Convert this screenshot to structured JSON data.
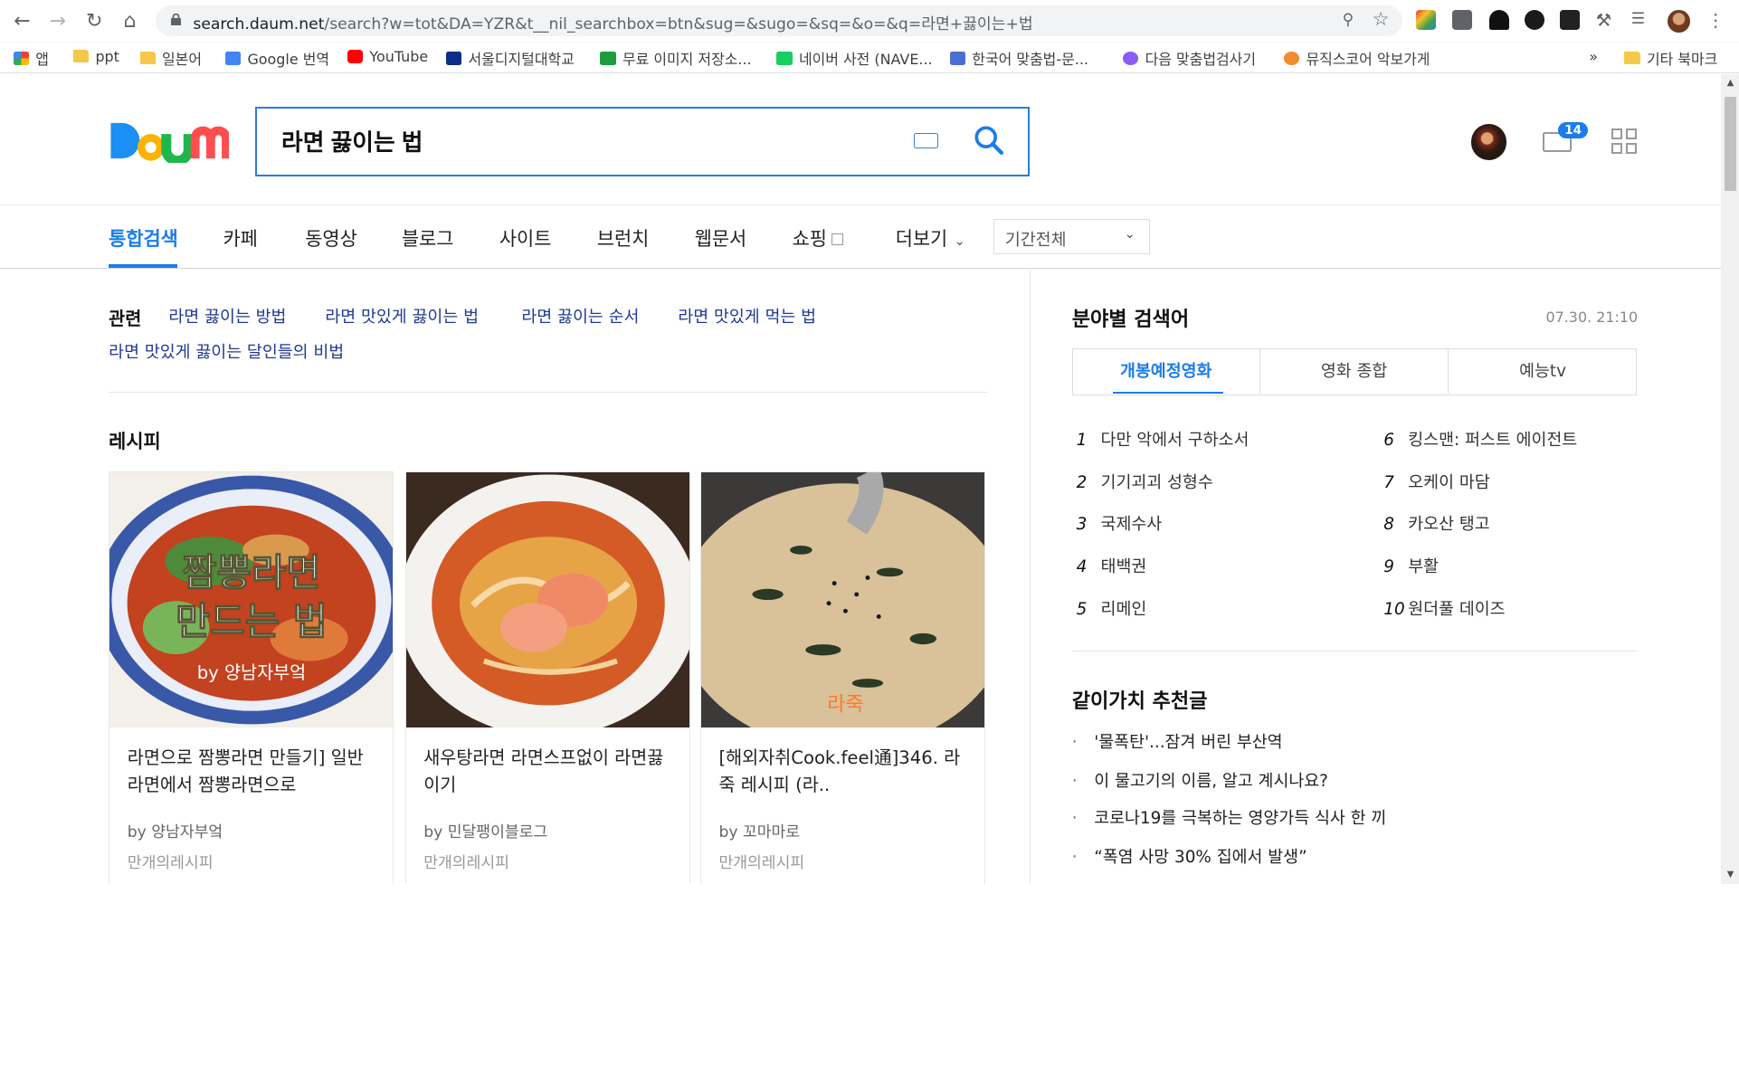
{
  "browser": {
    "url_domain": "search.daum.net",
    "url_rest": "/search?w=tot&DA=YZR&t__nil_searchbox=btn&sug=&sugo=&sq=&o=&q=라면+끓이는+법",
    "bookmarks": [
      {
        "label": "앱"
      },
      {
        "label": "ppt"
      },
      {
        "label": "일본어"
      },
      {
        "label": "Google 번역"
      },
      {
        "label": "YouTube"
      },
      {
        "label": "서울디지털대학교"
      },
      {
        "label": "무료 이미지 저장소..."
      },
      {
        "label": "네이버 사전 (NAVE..."
      },
      {
        "label": "한국어 맞춤법-문..."
      },
      {
        "label": "다음 맞춤법검사기"
      },
      {
        "label": "뮤직스코어 악보가게"
      },
      {
        "label": "»"
      },
      {
        "label": "기타 북마크"
      }
    ]
  },
  "header": {
    "search_query": "라면 끓이는 법",
    "mail_count": "14"
  },
  "tabs": [
    {
      "label": "통합검색"
    },
    {
      "label": "카페"
    },
    {
      "label": "동영상"
    },
    {
      "label": "블로그"
    },
    {
      "label": "사이트"
    },
    {
      "label": "브런치"
    },
    {
      "label": "웹문서"
    },
    {
      "label": "쇼핑"
    },
    {
      "label": "더보기"
    }
  ],
  "period_select": "기간전체",
  "related": {
    "label": "관련",
    "items": [
      "라면 끓이는 방법",
      "라면 맛있게 끓이는 법",
      "라면 끓이는 순서",
      "라면 맛있게 먹는 법",
      "라면 맛있게 끓이는 달인들의 비법"
    ]
  },
  "recipe": {
    "section_title": "레시피",
    "cards": [
      {
        "img_text": "짬뽕라면\n만드는 법",
        "img_credit": "by 양남자부엌",
        "title": "라면으로 짬뽕라면 만들기] 일반라면에서 짬뽕라면으로",
        "by": "by 양남자부엌",
        "source": "만개의레시피"
      },
      {
        "img_text": "",
        "img_credit": "",
        "title": "새우탕라면 라면스프없이 라면끓이기",
        "by": "by 민달팽이블로그",
        "source": "만개의레시피"
      },
      {
        "img_text": "라죽",
        "img_credit": "",
        "title": "[해외자취Cook.feel通]346. 라죽 레시피 (라..",
        "by": "by 꼬마마로",
        "source": "만개의레시피"
      }
    ]
  },
  "sidebar": {
    "title": "분야별 검색어",
    "time": "07.30. 21:10",
    "tabs": [
      "개봉예정영화",
      "영화 종합",
      "예능tv"
    ],
    "ranks": [
      {
        "n": "1",
        "label": "다만 악에서 구하소서"
      },
      {
        "n": "2",
        "label": "기기괴괴 성형수"
      },
      {
        "n": "3",
        "label": "국제수사"
      },
      {
        "n": "4",
        "label": "태백권"
      },
      {
        "n": "5",
        "label": "리메인"
      },
      {
        "n": "6",
        "label": "킹스맨: 퍼스트 에이전트"
      },
      {
        "n": "7",
        "label": "오케이 마담"
      },
      {
        "n": "8",
        "label": "카오산 탱고"
      },
      {
        "n": "9",
        "label": "부활"
      },
      {
        "n": "10",
        "label": "원더풀 데이즈"
      }
    ],
    "rec_title": "같이가치 추천글",
    "rec_items": [
      "'물폭탄'...잠겨 버린 부산역",
      "이 물고기의 이름, 알고 계시나요?",
      "코로나19를 극복하는 영양가득 식사 한 끼",
      "“폭염 사망 30% 집에서 발생”"
    ]
  }
}
